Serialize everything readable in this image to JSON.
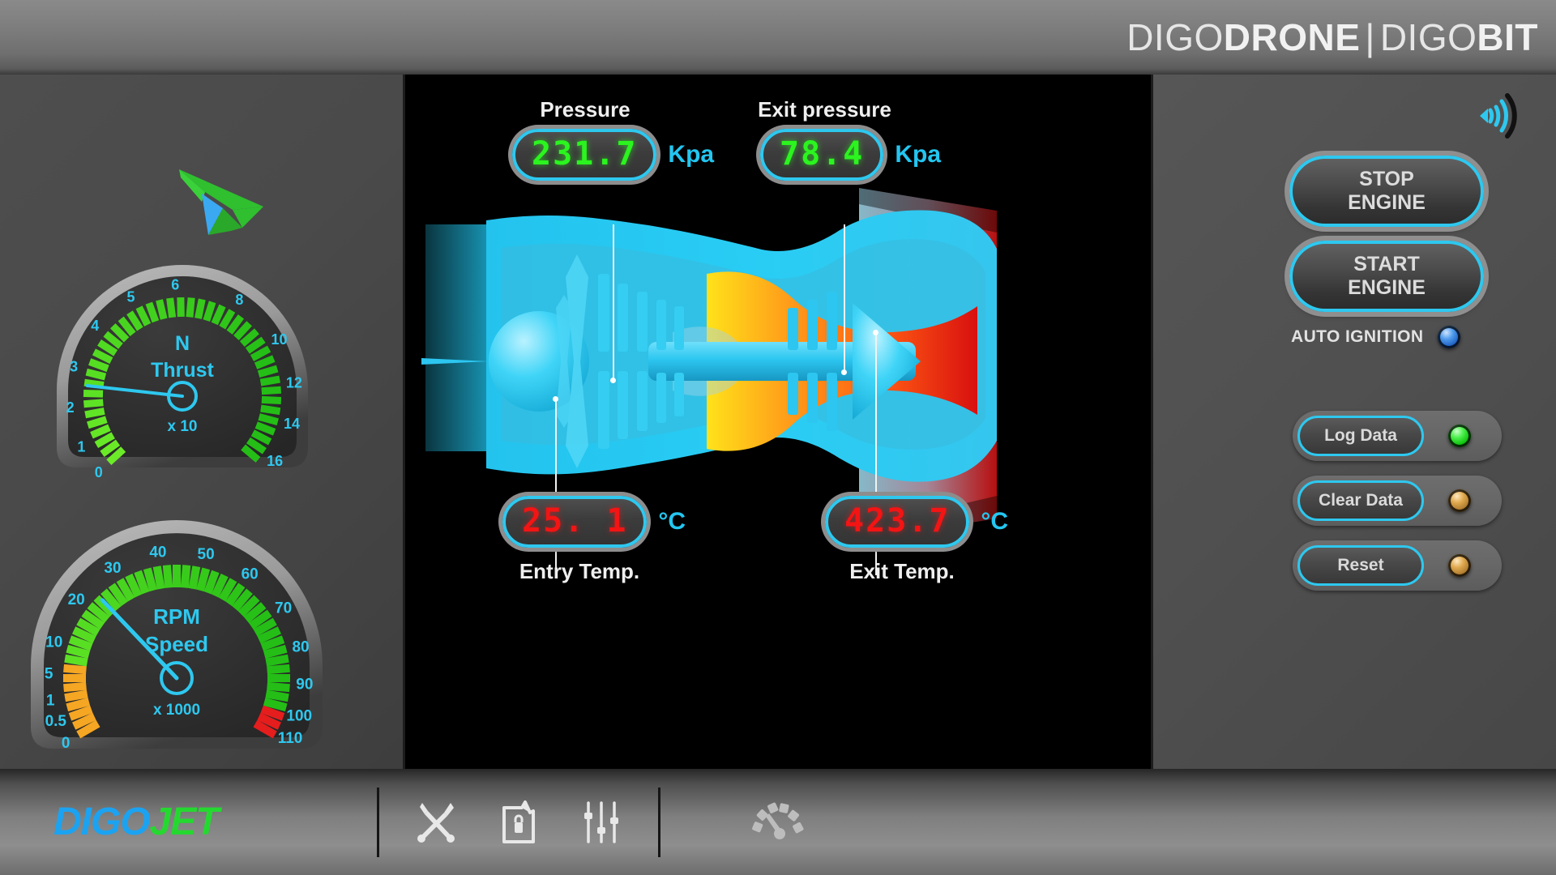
{
  "header": {
    "brand_light_1": "DIGO",
    "brand_bold_1": "DRONE",
    "separator": "|",
    "brand_light_2": "DIGO",
    "brand_bold_2": "BIT"
  },
  "left_panel": {
    "logo_icon": "drone-arrow-icon",
    "gauges": [
      {
        "id": "thrust",
        "title_line1": "N",
        "title_line2": "Thrust",
        "multiplier": "x 10",
        "value": 2.95,
        "min": 0,
        "max": 16,
        "ticks": [
          "0",
          "1",
          "2",
          "3",
          "4",
          "5",
          "6",
          "8",
          "10",
          "12",
          "14",
          "16"
        ],
        "tick_values": [
          0,
          1,
          2,
          3,
          4,
          5,
          6,
          8,
          10,
          12,
          14,
          16
        ],
        "needle_color": "#2ec8ef",
        "scale_color": "#3dd31f"
      },
      {
        "id": "rpm",
        "title_line1": "RPM",
        "title_line2": "Speed",
        "multiplier": "x 1000",
        "value": 35,
        "min": 0,
        "max": 110,
        "ticks": [
          "0",
          "0.5",
          "1",
          "5",
          "10",
          "20",
          "30",
          "40",
          "50",
          "60",
          "70",
          "80",
          "90",
          "100",
          "110"
        ],
        "tick_values": [
          0,
          0.5,
          1,
          5,
          10,
          20,
          30,
          40,
          50,
          60,
          70,
          80,
          90,
          100,
          110
        ],
        "needle_color": "#2ec8ef",
        "scale_color": "#3dd31f",
        "warn_color": "#f5a623",
        "danger_color": "#e51d1d"
      }
    ]
  },
  "center_panel": {
    "diagram_name": "jet-engine-cutaway-diagram",
    "readouts": [
      {
        "id": "pressure",
        "label": "Pressure",
        "value": "231.7",
        "unit": "Kpa",
        "color": "green",
        "label_position": "top"
      },
      {
        "id": "exit_pressure",
        "label": "Exit pressure",
        "value": "78.4",
        "unit": "Kpa",
        "color": "green",
        "label_position": "top"
      },
      {
        "id": "entry_temp",
        "label": "Entry Temp.",
        "value": "25. 1",
        "unit": "°C",
        "color": "red",
        "label_position": "bottom"
      },
      {
        "id": "exit_temp",
        "label": "Exit Temp.",
        "value": "423.7",
        "unit": "°C",
        "color": "red",
        "label_position": "bottom"
      }
    ]
  },
  "right_panel": {
    "signal_icon": "wireless-signal-icon",
    "stop_button": "STOP\nENGINE",
    "stop_button_line1": "STOP",
    "stop_button_line2": "ENGINE",
    "start_button_line1": "START",
    "start_button_line2": "ENGINE",
    "auto_ignition_label": "AUTO IGNITION",
    "auto_ignition_led": "blue",
    "data_buttons": [
      {
        "label": "Log Data",
        "led": "green"
      },
      {
        "label": "Clear Data",
        "led": "amber"
      },
      {
        "label": "Reset",
        "led": "amber"
      }
    ]
  },
  "footer": {
    "logo_part1": "DIGO",
    "logo_part2": "JET",
    "icons": [
      "tools-icon",
      "secure-folder-icon",
      "sliders-icon",
      "gauge-icon"
    ]
  },
  "colors": {
    "accent_cyan": "#2ec8ef",
    "lcd_green": "#2bf41f",
    "lcd_red": "#f31414",
    "logo_blue": "#1ba3f2",
    "logo_green": "#25d830",
    "panel_gray": "#4a4a4a"
  }
}
